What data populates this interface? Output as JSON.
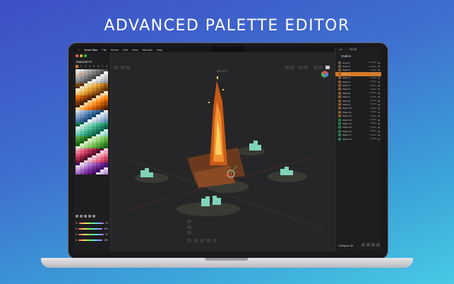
{
  "headline": "ADVANCED PALETTE EDITOR",
  "menubar": {
    "items": [
      "Voxel Max",
      "File",
      "Scene",
      "Edit",
      "View",
      "Window",
      "Help"
    ],
    "time": "13:29"
  },
  "left_panel": {
    "material_title": "Material #1",
    "palette_tabs": [
      "1",
      "2",
      "3",
      "4",
      "5",
      "6",
      "7",
      "8"
    ],
    "selected_tab": "1",
    "picker_labels": [
      "H",
      "S",
      "V",
      "A"
    ],
    "picker_values": [
      "24",
      "100",
      "97",
      "100"
    ]
  },
  "viewport": {
    "select_label": "SELECT"
  },
  "outline": {
    "title": "Outline",
    "rows": [
      {
        "name": "Group 2",
        "sub": "All Voxels",
        "selected": false,
        "color": "#6a5a50"
      },
      {
        "name": "Group 1",
        "sub": "All Voxels",
        "selected": false,
        "color": "#6a5a50"
      },
      {
        "name": "Object 0",
        "sub": "3 Voxels",
        "selected": false,
        "color": "#8a5a30"
      },
      {
        "name": "Object 1",
        "sub": "2 Voxels",
        "selected": true,
        "color": "#b05a20"
      },
      {
        "name": "Object 2",
        "sub": "2 Voxels",
        "selected": false,
        "color": "#8a5a30"
      },
      {
        "name": "Object 3",
        "sub": "2 Voxels",
        "selected": false,
        "color": "#8a5a30"
      },
      {
        "name": "Object 4",
        "sub": "2 Voxels",
        "selected": false,
        "color": "#8a5a30"
      },
      {
        "name": "Object 5",
        "sub": "2 Voxels",
        "selected": false,
        "color": "#8a5a30"
      },
      {
        "name": "Object 6",
        "sub": "2 Voxels",
        "selected": false,
        "color": "#8a5a30"
      },
      {
        "name": "Object 7",
        "sub": "2 Voxels",
        "selected": false,
        "color": "#8a5a30"
      },
      {
        "name": "Object 8",
        "sub": "2 Voxels",
        "selected": false,
        "color": "#8a5a30"
      },
      {
        "name": "Object 9",
        "sub": "2 Voxels",
        "selected": false,
        "color": "#8a5a30"
      },
      {
        "name": "Object 10",
        "sub": "2 Voxels",
        "selected": false,
        "color": "#8a5a30"
      },
      {
        "name": "Object 11",
        "sub": "2 Voxels",
        "selected": false,
        "color": "#8a5a30"
      },
      {
        "name": "Object 12",
        "sub": "2 Voxels",
        "selected": false,
        "color": "#8a5a30"
      },
      {
        "name": "Object 13",
        "sub": "2 Voxels",
        "selected": false,
        "color": "#2e7a4a"
      },
      {
        "name": "Object 14",
        "sub": "2 Voxels",
        "selected": false,
        "color": "#2e7a4a"
      },
      {
        "name": "Object 15",
        "sub": "2 Voxels",
        "selected": false,
        "color": "#2e7a4a"
      },
      {
        "name": "Object 16",
        "sub": "2 Voxels",
        "selected": false,
        "color": "#2e7a4a"
      },
      {
        "name": "Object 17",
        "sub": "2 Voxels",
        "selected": false,
        "color": "#2e7a4a"
      },
      {
        "name": "Object 18",
        "sub": "2 Voxels",
        "selected": false,
        "color": "#2e7a4a"
      }
    ],
    "collapse_label": "Collapse All"
  },
  "colors": {
    "accent": "#e88a2a",
    "panel_bg": "#1e1e20",
    "viewport_bg": "#262628"
  }
}
